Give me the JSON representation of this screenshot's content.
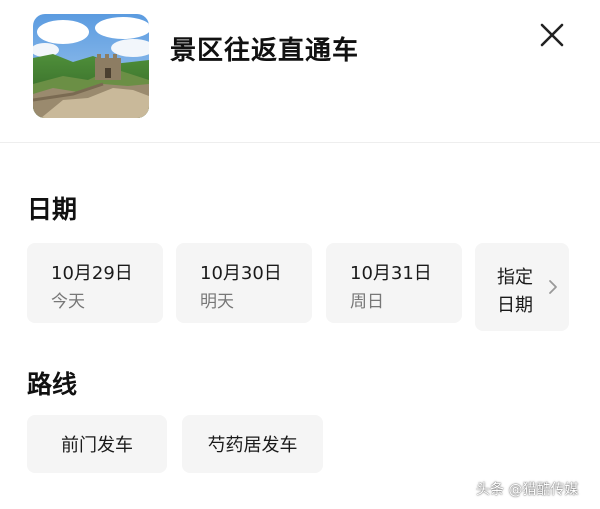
{
  "header": {
    "title": "景区往返直通车",
    "thumbnail_icon": "great-wall-photo",
    "close_icon": "close-icon"
  },
  "date_section": {
    "title": "日期",
    "dates": [
      {
        "date": "10月29日",
        "label": "今天"
      },
      {
        "date": "10月30日",
        "label": "明天"
      },
      {
        "date": "10月31日",
        "label": "周日"
      }
    ],
    "custom": {
      "line1": "指定",
      "line2": "日期",
      "icon": "chevron-right-icon"
    }
  },
  "route_section": {
    "title": "路线",
    "options": [
      "前门发车",
      "芍药居发车"
    ]
  },
  "watermark": "头条 @猎酷传媒",
  "colors": {
    "card_bg": "#f5f5f5",
    "text_primary": "#111111",
    "text_secondary": "#777777",
    "divider": "#eeeeee"
  }
}
